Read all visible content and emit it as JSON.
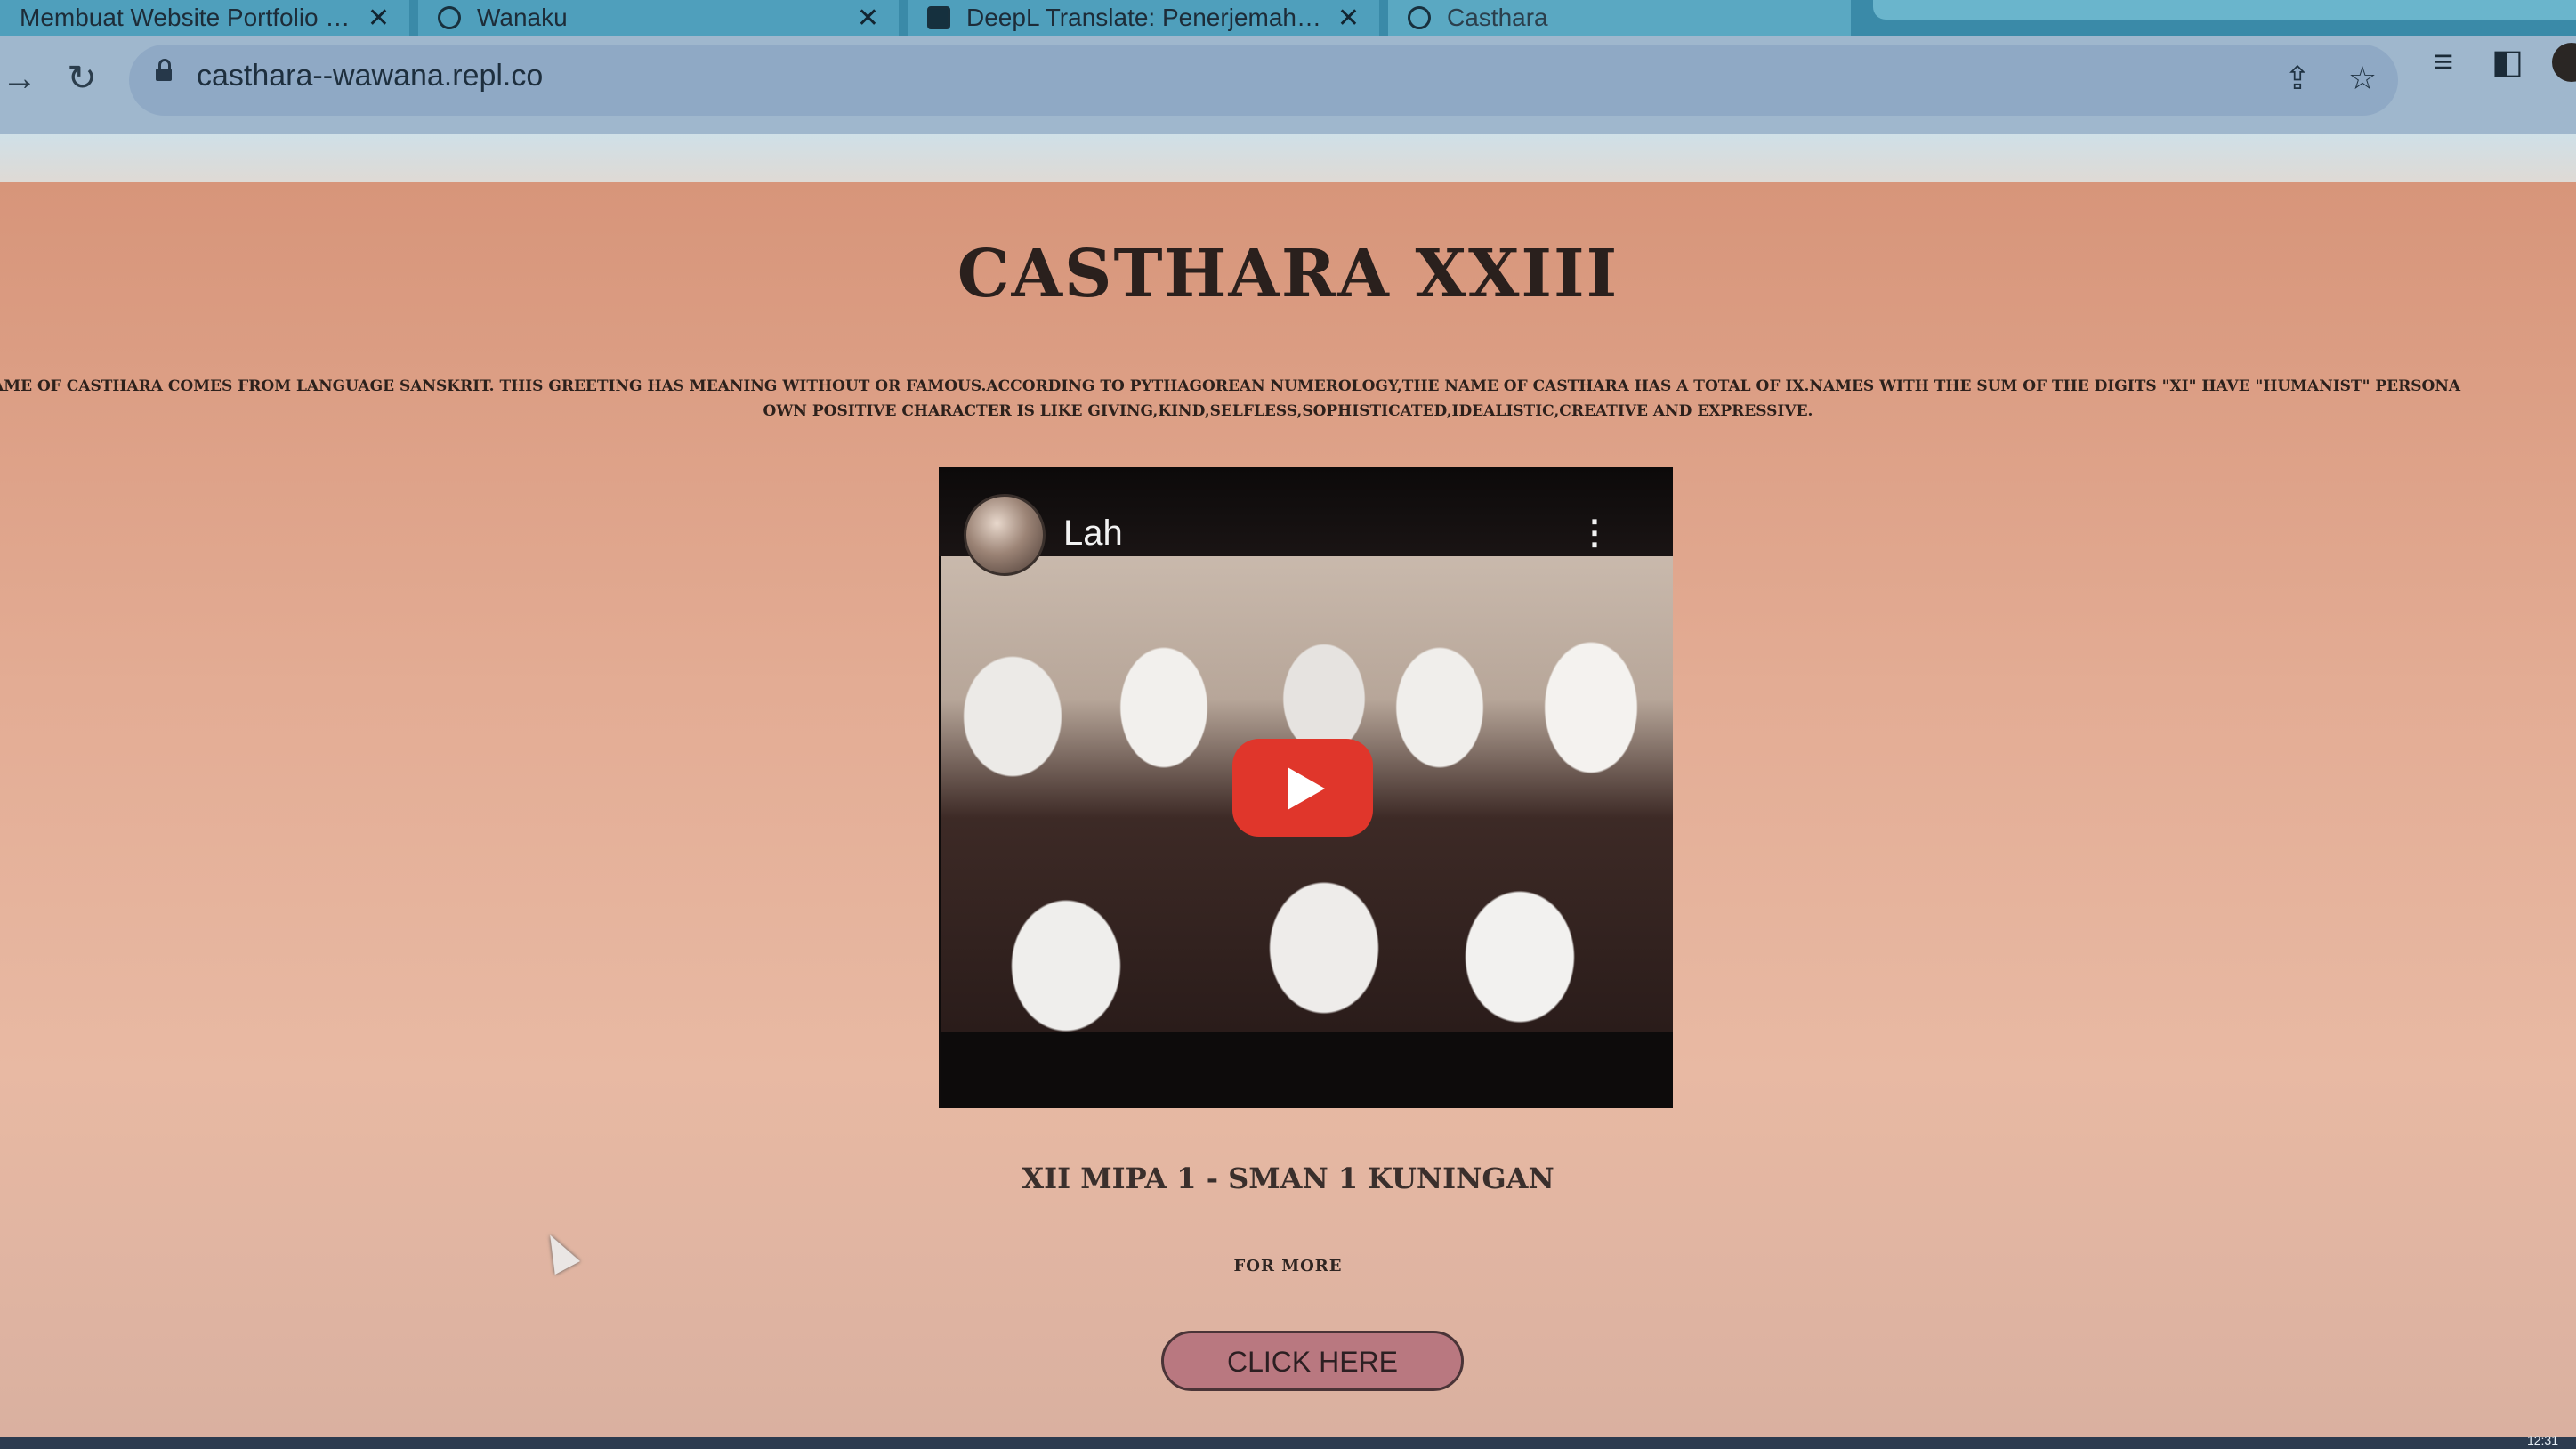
{
  "browser": {
    "tabs": [
      {
        "title": "Membuat Website Portfolio Men",
        "close": "✕"
      },
      {
        "title": "Wanaku",
        "close": "✕"
      },
      {
        "title": "DeepL Translate: Penerjemah pal",
        "close": "✕"
      },
      {
        "title": "Casthara",
        "close": ""
      }
    ],
    "url": "casthara--wawana.repl.co",
    "icons": {
      "back": "back-arrow-icon",
      "forward": "forward-arrow-icon",
      "reload": "reload-icon",
      "share": "share-icon",
      "bookmark": "star-icon",
      "media": "media-queue-icon",
      "sidepanel": "side-panel-icon"
    }
  },
  "page": {
    "title": "CASTHARA XXIII",
    "description_line1": "EANING NAME OF CASTHARA COMES FROM LANGUAGE SANSKRIT. THIS GREETING HAS MEANING WITHOUT OR FAMOUS.ACCORDING TO PYTHAGOREAN NUMEROLOGY,THE NAME OF CASTHARA HAS A TOTAL OF IX.NAMES WITH THE SUM OF THE DIGITS \"XI\" HAVE \"HUMANIST\" PERSONA",
    "description_line2": "OWN POSITIVE CHARACTER IS LIKE GIVING,KIND,SELFLESS,SOPHISTICATED,IDEALISTIC,CREATIVE AND EXPRESSIVE.",
    "video": {
      "channel_title": "Lah",
      "menu_glyph": "⋮"
    },
    "class_name": "XII MIPA 1 - SMAN 1 KUNINGAN",
    "for_more": "FOR MORE",
    "cta_label": "CLICK HERE"
  },
  "system": {
    "clock": "12:31"
  },
  "colors": {
    "page_bg": "#e3ac94",
    "button_bg": "#b97880",
    "play_red": "#e0362b"
  }
}
